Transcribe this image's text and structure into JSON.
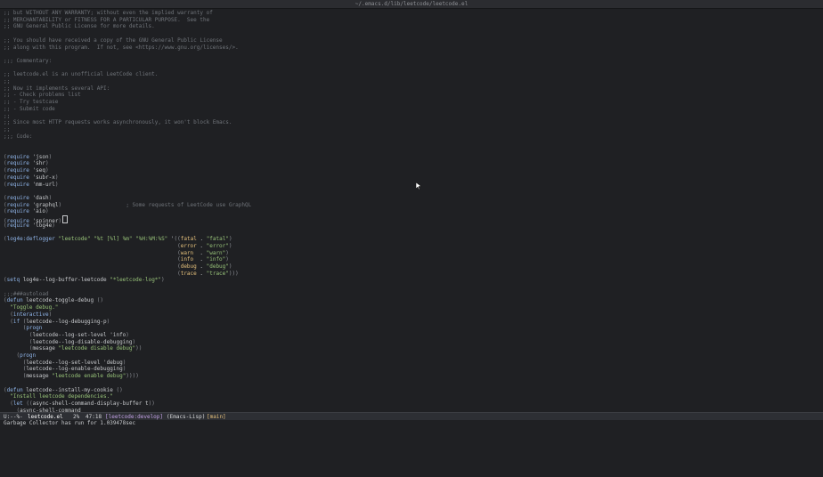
{
  "window": {
    "title": "~/.emacs.d/lib/leetcode/leetcode.el"
  },
  "editor": {
    "lines": [
      ";; but WITHOUT ANY WARRANTY; without even the implied warranty of",
      ";; MERCHANTABILITY or FITNESS FOR A PARTICULAR PURPOSE.  See the",
      ";; GNU General Public License for more details.",
      "",
      ";; You should have received a copy of the GNU General Public License",
      ";; along with this program.  If not, see <https://www.gnu.org/licenses/>.",
      "",
      ";;; Commentary:",
      "",
      ";; leetcode.el is an unofficial LeetCode client.",
      ";;",
      ";; Now it implements several API:",
      ";; - Check problems list",
      ";; - Try testcase",
      ";; - Submit code",
      ";;",
      ";; Since most HTTP requests works asynchronously, it won't block Emacs.",
      ";;",
      ";;; Code:",
      "",
      "",
      "(require 'json)",
      "(require 'shr)",
      "(require 'seq)",
      "(require 'subr-x)",
      "(require 'mm-url)",
      "",
      "(require 'dash)",
      "(require 'graphql)                    ; Some requests of LeetCode use GraphQL",
      "(require 'aio)",
      "(require 'spinner)",
      "(require 'log4e)",
      "",
      "(log4e:deflogger \"leetcode\" \"%t [%l] %m\" \"%H:%M:%S\" '((fatal . \"fatal\")",
      "                                                      (error . \"error\")",
      "                                                      (warn  . \"warn\")",
      "                                                      (info  . \"info\")",
      "                                                      (debug . \"debug\")",
      "                                                      (trace . \"trace\")))",
      "(setq log4e--log-buffer-leetcode \"*leetcode-log*\")",
      "",
      ";;;###autoload",
      "(defun leetcode-toggle-debug ()",
      "  \"Toggle debug.\"",
      "  (interactive)",
      "  (if (leetcode--log-debugging-p)",
      "      (progn",
      "        (leetcode--log-set-level 'info)",
      "        (leetcode--log-disable-debugging)",
      "        (message \"leetcode disable debug\"))",
      "    (progn",
      "      (leetcode--log-set-level 'debug)",
      "      (leetcode--log-enable-debugging)",
      "      (message \"leetcode enable debug\"))))",
      "",
      "(defun leetcode--install-my-cookie ()",
      "  \"Install leetcode dependencies.\"",
      "  (let ((async-shell-command-display-buffer t))",
      "    (async-shell-command"
    ]
  },
  "modeline": {
    "status": "U:--%-",
    "buffer": "leetcode.el",
    "percent": "2%",
    "position": "47:18",
    "branch": "[leetcode:develop]",
    "mode": "(Emacs-Lisp)",
    "extra": "[main]"
  },
  "minibuffer": {
    "message": "Garbage Collector has run for 1.039478sec"
  },
  "colors": {
    "background": "#1f2023",
    "comment": "#6f7379",
    "keyword": "#8fb4e8",
    "string": "#98c379",
    "modeline_bg": "#2d2f34"
  }
}
